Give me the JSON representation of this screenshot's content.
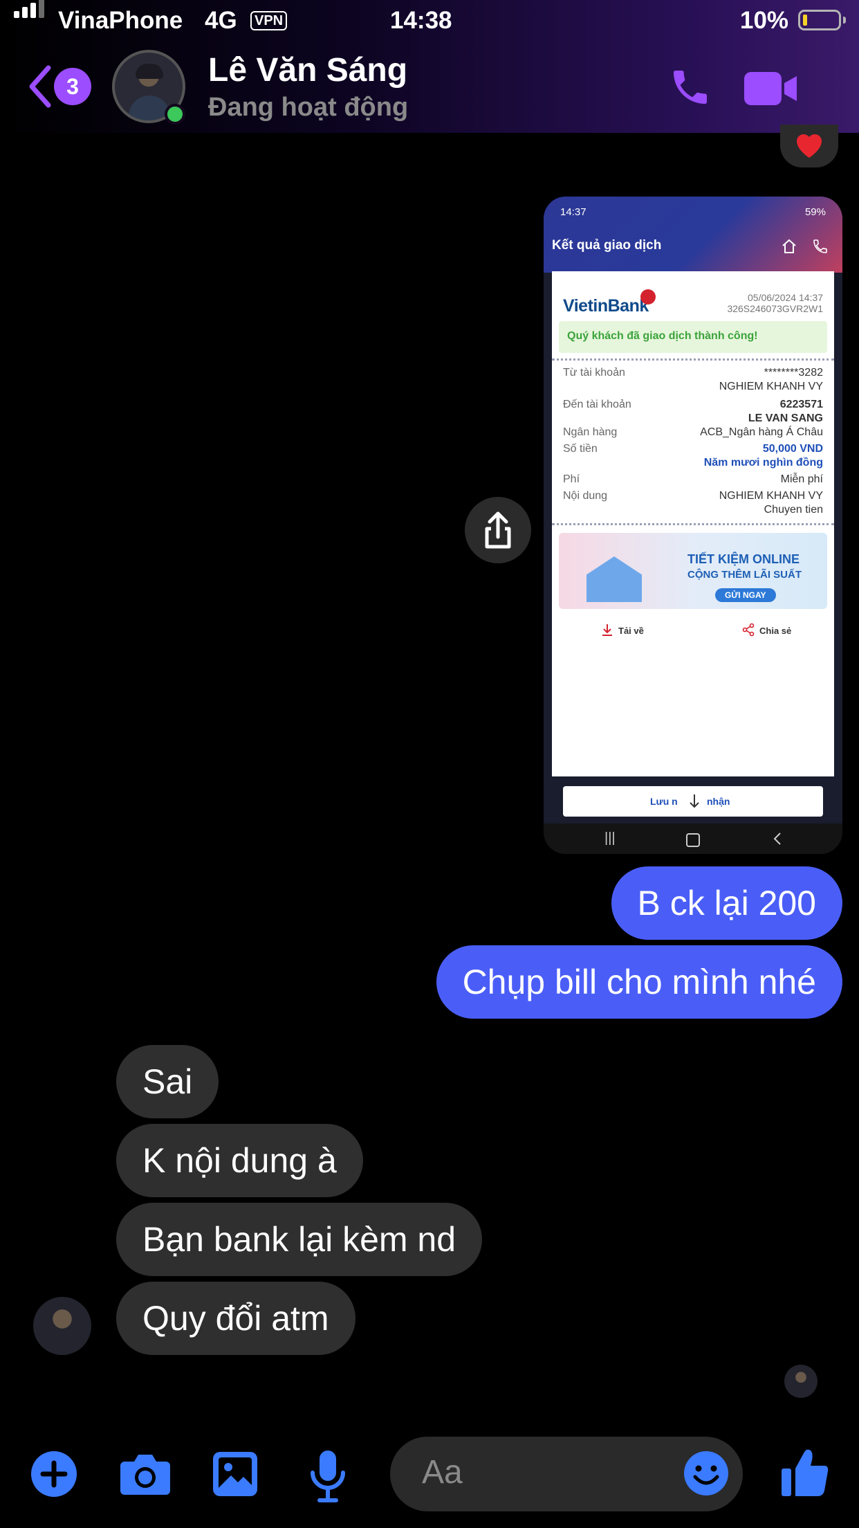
{
  "status_bar": {
    "carrier": "VinaPhone",
    "network": "4G",
    "vpn": "VPN",
    "time": "14:38",
    "battery": "10%"
  },
  "header": {
    "unread_count": "3",
    "name": "Lê Văn Sáng",
    "status": "Đang hoạt động"
  },
  "shared_image": {
    "status_time": "14:37",
    "status_battery": "59%",
    "title": "Kết quả giao dịch",
    "bank": "VietinBank",
    "datetime": "05/06/2024 14:37",
    "txn_id": "326S246073GVR2W1",
    "success_msg": "Quý khách đã giao dịch thành công!",
    "rows": {
      "from_label": "Từ tài khoản",
      "from_acct": "********3282",
      "from_name": "NGHIEM KHANH VY",
      "to_label": "Đến tài khoản",
      "to_acct": "6223571",
      "to_name": "LE VAN SANG",
      "bank_label": "Ngân hàng",
      "bank_value": "ACB_Ngân hàng Á Châu",
      "amount_label": "Số tiền",
      "amount_value": "50,000 VND",
      "amount_words": "Năm mươi nghìn đồng",
      "fee_label": "Phí",
      "fee_value": "Miễn phí",
      "content_label": "Nội dung",
      "content_line1": "NGHIEM KHANH VY",
      "content_line2": "Chuyen tien"
    },
    "promo": {
      "line1": "TIẾT KIỆM ONLINE",
      "line2": "CỘNG THÊM LÃI SUẤT",
      "button": "GỬI NGAY"
    },
    "download": "Tải về",
    "share": "Chia sẻ",
    "save_button": "Lưu n",
    "save_button_tail": "nhận"
  },
  "messages": {
    "sent": [
      "B ck lại 200",
      "Chụp bill cho mình nhé"
    ],
    "received": [
      "Sai",
      "K nội dung à",
      "Bạn bank lại kèm nd",
      "Quy đổi atm"
    ]
  },
  "composer": {
    "placeholder": "Aa"
  },
  "colors": {
    "accent_purple": "#9b4dff",
    "sent_bubble": "#4a5ef7",
    "received_bubble": "#2f2f2f",
    "composer_icons": "#3b7bff"
  }
}
